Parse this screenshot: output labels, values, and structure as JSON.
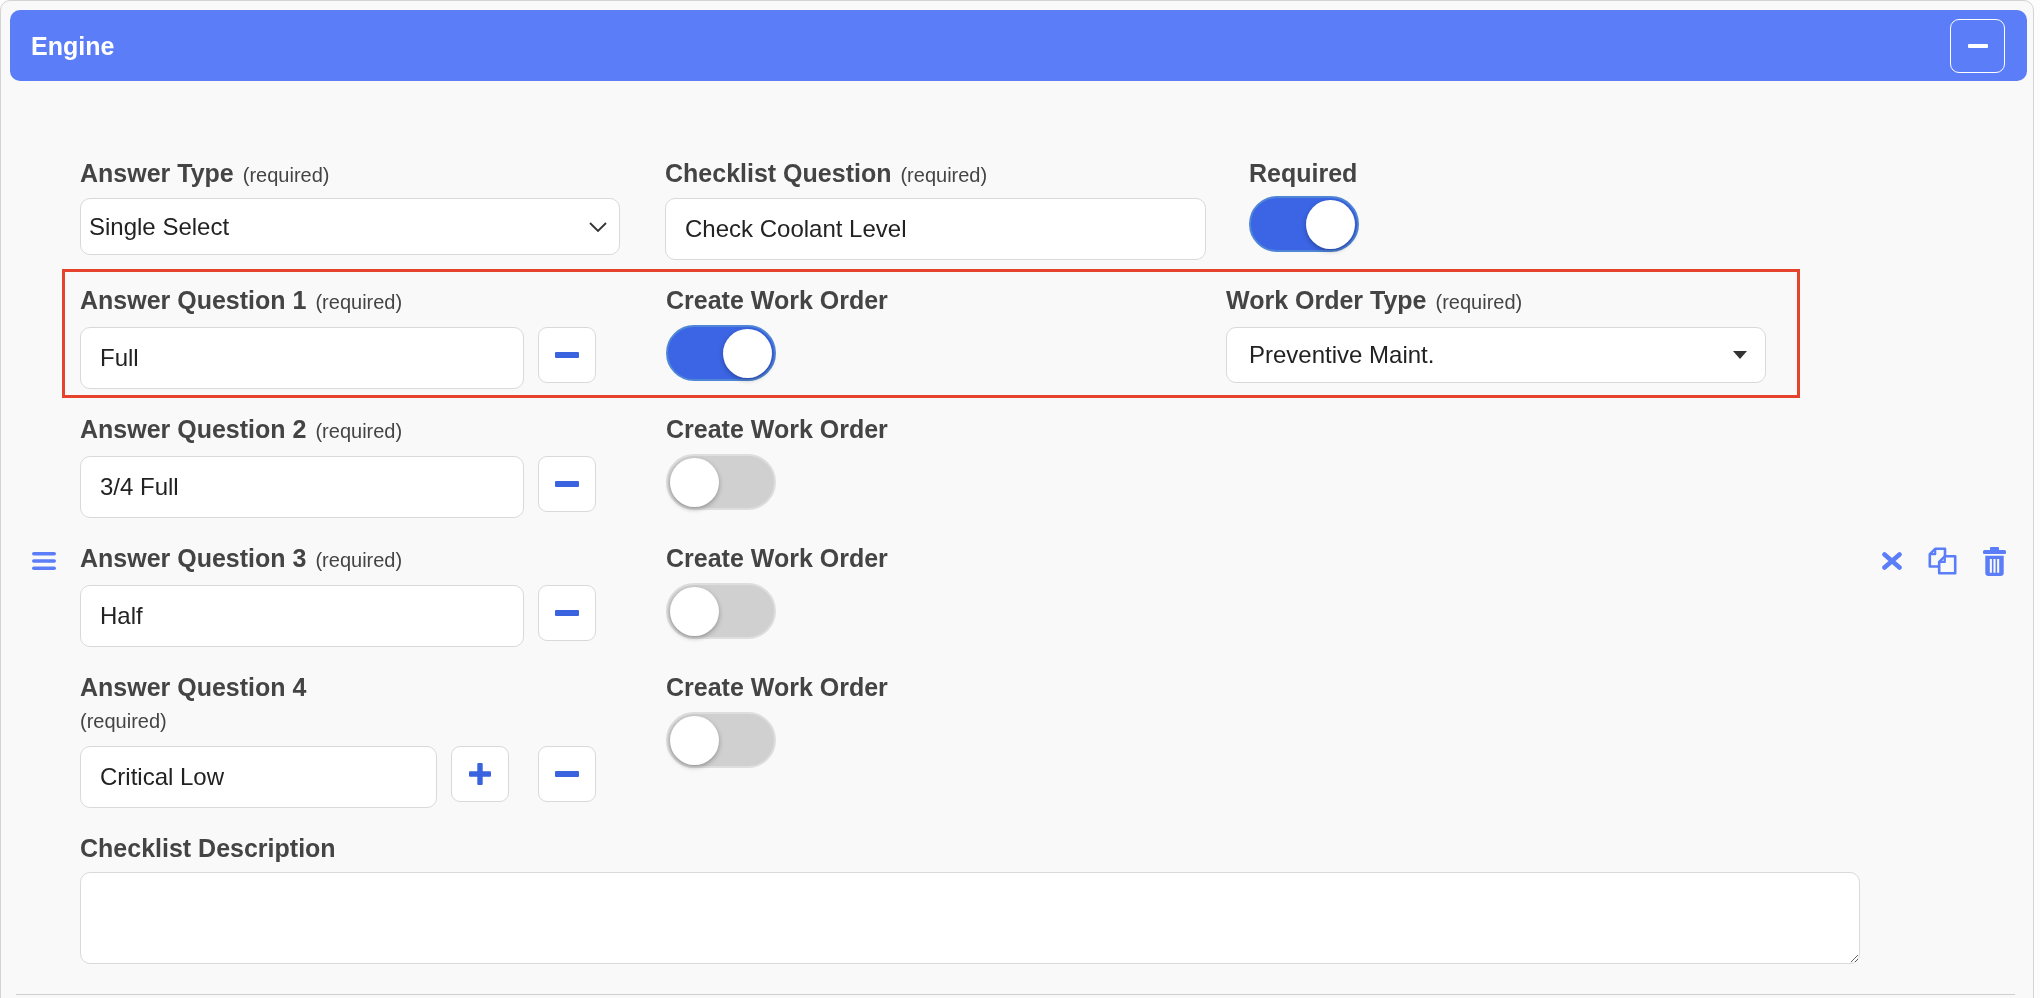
{
  "section": {
    "title": "Engine",
    "expanded": true
  },
  "answer_type": {
    "label": "Answer Type",
    "note": "(required)",
    "value": "Single Select"
  },
  "checklist_question": {
    "label": "Checklist Question",
    "note": "(required)",
    "value": "Check Coolant Level"
  },
  "required": {
    "label": "Required",
    "on": true
  },
  "answers": [
    {
      "label": "Answer Question 1",
      "note": "(required)",
      "value": "Full",
      "highlighted": true,
      "can_add": false,
      "create_work_order": {
        "label": "Create Work Order",
        "on": true
      },
      "work_order_type": {
        "label": "Work Order Type",
        "note": "(required)",
        "value": "Preventive Maint."
      }
    },
    {
      "label": "Answer Question 2",
      "note": "(required)",
      "value": "3/4 Full",
      "highlighted": false,
      "can_add": false,
      "create_work_order": {
        "label": "Create Work Order",
        "on": false
      }
    },
    {
      "label": "Answer Question 3",
      "note": "(required)",
      "value": "Half",
      "highlighted": false,
      "can_add": false,
      "create_work_order": {
        "label": "Create Work Order",
        "on": false
      }
    },
    {
      "label": "Answer Question 4",
      "note": "(required)",
      "value": "Critical Low",
      "highlighted": false,
      "can_add": true,
      "create_work_order": {
        "label": "Create Work Order",
        "on": false
      }
    }
  ],
  "description": {
    "label": "Checklist Description"
  }
}
